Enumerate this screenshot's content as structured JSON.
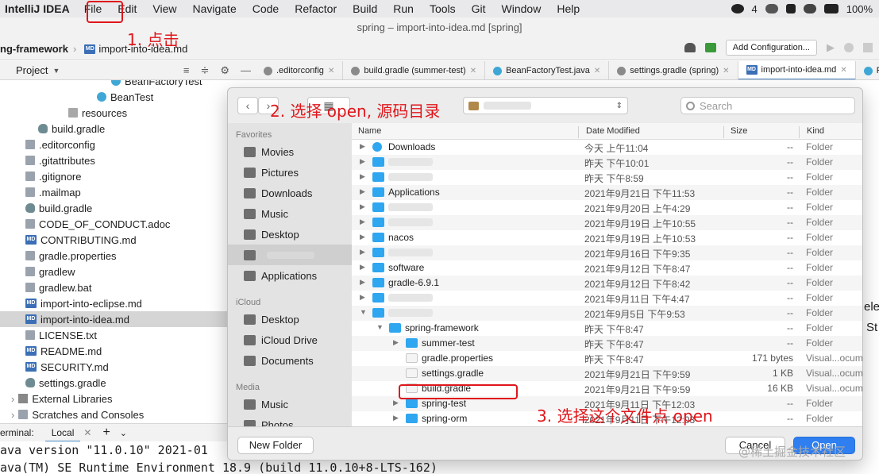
{
  "menubar": {
    "app": "IntelliJ IDEA",
    "menus": [
      "File",
      "Edit",
      "View",
      "Navigate",
      "Code",
      "Refactor",
      "Build",
      "Run",
      "Tools",
      "Git",
      "Window",
      "Help"
    ],
    "status": {
      "notif_count": "4",
      "battery": "100%"
    }
  },
  "window_title": "spring – import-into-idea.md [spring]",
  "toolbar": {
    "project_crumb": "ng-framework",
    "file_crumb": "import-into-idea.md",
    "config_button": "Add Configuration..."
  },
  "project_panel": {
    "label": "Project"
  },
  "editor_tabs": [
    ".editorconfig",
    "build.gradle (summer-test)",
    "BeanFactoryTest.java",
    "settings.gradle (spring)",
    "import-into-idea.md",
    "F"
  ],
  "tree": [
    {
      "label": "BeanFactoryTest",
      "icon": "class-icon"
    },
    {
      "label": "BeanTest",
      "icon": "class-icon"
    },
    {
      "label": "resources",
      "icon": "folder-icon"
    },
    {
      "label": "build.gradle",
      "icon": "gradle-icon"
    },
    {
      "label": ".editorconfig",
      "icon": "settings-file-icon"
    },
    {
      "label": ".gitattributes",
      "icon": "file-icon"
    },
    {
      "label": ".gitignore",
      "icon": "file-icon"
    },
    {
      "label": ".mailmap",
      "icon": "file-icon"
    },
    {
      "label": "build.gradle",
      "icon": "gradle-icon"
    },
    {
      "label": "CODE_OF_CONDUCT.adoc",
      "icon": "file-icon"
    },
    {
      "label": "CONTRIBUTING.md",
      "icon": "markdown-icon"
    },
    {
      "label": "gradle.properties",
      "icon": "file-icon"
    },
    {
      "label": "gradlew",
      "icon": "file-icon"
    },
    {
      "label": "gradlew.bat",
      "icon": "file-icon"
    },
    {
      "label": "import-into-eclipse.md",
      "icon": "markdown-icon"
    },
    {
      "label": "import-into-idea.md",
      "icon": "markdown-icon"
    },
    {
      "label": "LICENSE.txt",
      "icon": "file-icon"
    },
    {
      "label": "README.md",
      "icon": "markdown-icon"
    },
    {
      "label": "SECURITY.md",
      "icon": "markdown-icon"
    },
    {
      "label": "settings.gradle",
      "icon": "gradle-icon"
    },
    {
      "label": "External Libraries",
      "icon": "library-icon"
    },
    {
      "label": "Scratches and Consoles",
      "icon": "scratches-icon"
    }
  ],
  "terminal": {
    "label": "erminal:",
    "tab": "Local",
    "lines": [
      "ava version \"11.0.10\" 2021-01",
      "ava(TM) SE Runtime Environment 18.9 (build 11.0.10+8-LTS-162)"
    ]
  },
  "editor_fragments": [
    "elec",
    "St"
  ],
  "dialog": {
    "search_placeholder": "Search",
    "columns": {
      "name": "Name",
      "date": "Date Modified",
      "size": "Size",
      "kind": "Kind"
    },
    "sidebar": {
      "favorites_header": "Favorites",
      "favorites": [
        "Movies",
        "Pictures",
        "Downloads",
        "Music",
        "Desktop",
        "",
        "Applications"
      ],
      "icloud_header": "iCloud",
      "icloud": [
        "Desktop",
        "iCloud Drive",
        "Documents"
      ],
      "media_header": "Media",
      "media": [
        "Music",
        "Photos"
      ]
    },
    "rows": [
      {
        "name": "Downloads",
        "date": "今天 上午11:04",
        "size": "--",
        "kind": "Folder"
      },
      {
        "name": "",
        "date": "昨天 下午10:01",
        "size": "--",
        "kind": "Folder"
      },
      {
        "name": "",
        "date": "昨天 下午8:59",
        "size": "--",
        "kind": "Folder"
      },
      {
        "name": "Applications",
        "date": "2021年9月21日 下午11:53",
        "size": "--",
        "kind": "Folder"
      },
      {
        "name": "",
        "date": "2021年9月20日 上午4:29",
        "size": "--",
        "kind": "Folder"
      },
      {
        "name": "",
        "date": "2021年9月19日 上午10:55",
        "size": "--",
        "kind": "Folder"
      },
      {
        "name": "nacos",
        "date": "2021年9月19日 上午10:53",
        "size": "--",
        "kind": "Folder"
      },
      {
        "name": "",
        "date": "2021年9月16日 下午9:35",
        "size": "--",
        "kind": "Folder"
      },
      {
        "name": "software",
        "date": "2021年9月12日 下午8:47",
        "size": "--",
        "kind": "Folder"
      },
      {
        "name": "gradle-6.9.1",
        "date": "2021年9月12日 下午8:42",
        "size": "--",
        "kind": "Folder"
      },
      {
        "name": "",
        "date": "2021年9月11日 下午4:47",
        "size": "--",
        "kind": "Folder"
      },
      {
        "name": "",
        "date": "2021年9月5日 下午9:53",
        "size": "--",
        "kind": "Folder"
      },
      {
        "name": "spring-framework",
        "date": "昨天 下午8:47",
        "size": "--",
        "kind": "Folder"
      },
      {
        "name": "summer-test",
        "date": "昨天 下午8:47",
        "size": "--",
        "kind": "Folder"
      },
      {
        "name": "gradle.properties",
        "date": "昨天 下午8:47",
        "size": "171 bytes",
        "kind": "Visual...ocum"
      },
      {
        "name": "settings.gradle",
        "date": "2021年9月21日 下午9:59",
        "size": "1 KB",
        "kind": "Visual...ocum"
      },
      {
        "name": "build.gradle",
        "date": "2021年9月21日 下午9:59",
        "size": "16 KB",
        "kind": "Visual...ocum"
      },
      {
        "name": "spring-test",
        "date": "2021年9月11日 下午12:03",
        "size": "--",
        "kind": "Folder"
      },
      {
        "name": "spring-orm",
        "date": "2021年9月11日 下午12:03",
        "size": "--",
        "kind": "Folder"
      }
    ],
    "buttons": {
      "new_folder": "New Folder",
      "cancel": "Cancel",
      "open": "Open"
    }
  },
  "annotations": {
    "step1": "1. 点击",
    "step2": "2. 选择 open, 源码目录",
    "step3": "3. 选择这个文件点 open"
  },
  "watermark": "@稀土掘金技术社区",
  "colors": {
    "annotation": "#e0161b",
    "accent": "#2f7ff0",
    "folder": "#2ea6f0"
  }
}
